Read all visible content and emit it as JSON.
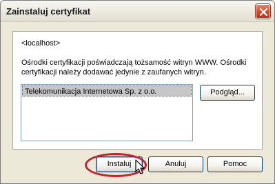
{
  "window": {
    "title": "Zainstaluj certyfikat"
  },
  "content": {
    "host": "<localhost>",
    "description": "Ośrodki certyfikacji poświadczają tożsamość witryn WWW. Ośrodki certyfikacji należy dodawać jedynie z zaufanych witryn.",
    "list_items": [
      "Telekomunikacja Internetowa Sp. z o.o."
    ],
    "preview_button": "Podgląd..."
  },
  "buttons": {
    "install": "Instaluj",
    "cancel": "Anuluj",
    "help": "Pomoc"
  },
  "colors": {
    "highlight": "#c8202e",
    "close_button": "#cf4b2c"
  }
}
